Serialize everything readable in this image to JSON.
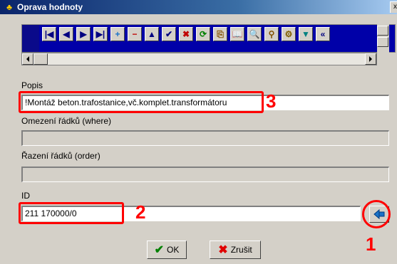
{
  "window": {
    "title": "Oprava hodnoty",
    "close_glyph": "x"
  },
  "navigator": {
    "buttons": [
      {
        "name": "first-record-icon",
        "glyph": "|◀"
      },
      {
        "name": "prior-record-icon",
        "glyph": "◀"
      },
      {
        "name": "next-record-icon",
        "glyph": "▶"
      },
      {
        "name": "last-record-icon",
        "glyph": "▶|"
      },
      {
        "name": "insert-record-icon",
        "glyph": "+"
      },
      {
        "name": "delete-record-icon",
        "glyph": "−"
      },
      {
        "name": "edit-record-icon",
        "glyph": "▲"
      },
      {
        "name": "post-record-icon",
        "glyph": "✔"
      },
      {
        "name": "cancel-record-icon",
        "glyph": "✖"
      },
      {
        "name": "refresh-icon",
        "glyph": "⟳"
      },
      {
        "name": "copy-icon",
        "glyph": "⎘"
      },
      {
        "name": "book-icon",
        "glyph": "📖"
      },
      {
        "name": "find-icon",
        "glyph": "🔍"
      },
      {
        "name": "find-next-icon",
        "glyph": "⚲"
      },
      {
        "name": "settings-icon",
        "glyph": "⚙"
      },
      {
        "name": "filter-icon",
        "glyph": "▼"
      },
      {
        "name": "more-icon",
        "glyph": "«"
      }
    ]
  },
  "fields": {
    "popis": {
      "label": "Popis",
      "value": "!Montáž beton.trafostanice,vč.komplet.transformátoru"
    },
    "where": {
      "label": "Omezení řádků (where)",
      "value": ""
    },
    "order": {
      "label": "Řazení řádků (order)",
      "value": ""
    },
    "id": {
      "label": "ID",
      "value": "211 170000/0"
    }
  },
  "annotations": {
    "n1": "1",
    "n2": "2",
    "n3": "3"
  },
  "buttons": {
    "ok": "OK",
    "cancel": "Zrušit"
  },
  "colors": {
    "highlight": "#ff0000",
    "nav_bg": "#0000a8",
    "title_bg": "#0a246a"
  }
}
